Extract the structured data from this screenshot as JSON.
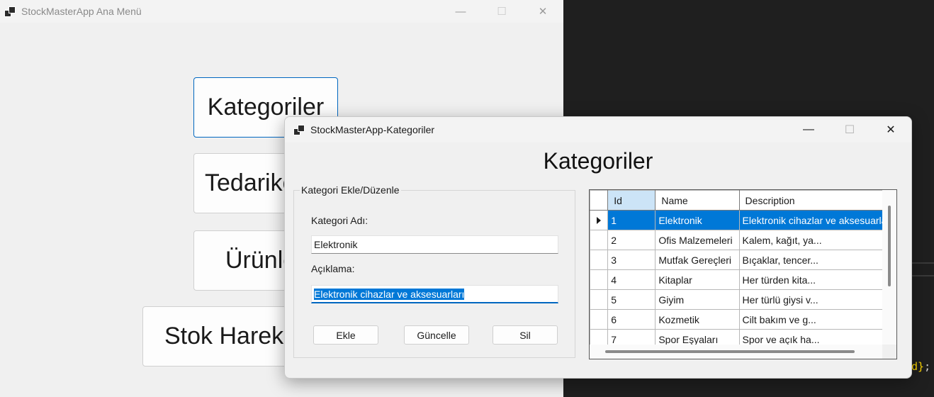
{
  "main_window": {
    "title": "StockMasterApp Ana Menü",
    "controls": {
      "minimize": "—",
      "maximize": "☐",
      "close": "✕"
    },
    "buttons": {
      "kategoriler": "Kategoriler",
      "tedarikciler": "Tedarikç",
      "urunler": "Ürünle",
      "stok_hareketleri": "Stok Hareke"
    }
  },
  "editor": {
    "snippet_bracket": "d}",
    "snippet_rest": ";"
  },
  "kategoriler_window": {
    "title": "StockMasterApp-Kategoriler",
    "controls": {
      "minimize": "—",
      "maximize": "☐",
      "close": "✕"
    },
    "heading": "Kategoriler",
    "groupbox": {
      "legend": "Kategori Ekle/Düzenle",
      "kategori_adi_label": "Kategori Adı:",
      "kategori_adi_value": "Elektronik",
      "aciklama_label": "Açıklama:",
      "aciklama_value": "Elektronik cihazlar ve aksesuarları",
      "buttons": {
        "ekle": "Ekle",
        "guncelle": "Güncelle",
        "sil": "Sil"
      }
    },
    "grid": {
      "columns": [
        "Id",
        "Name",
        "Description"
      ],
      "rows": [
        {
          "id": "1",
          "name": "Elektronik",
          "description": "Elektronik cihazlar ve aksesuarları",
          "selected": true
        },
        {
          "id": "2",
          "name": "Ofis Malzemeleri",
          "description": "Kalem, kağıt, ya..."
        },
        {
          "id": "3",
          "name": "Mutfak Gereçleri",
          "description": "Bıçaklar, tencer..."
        },
        {
          "id": "4",
          "name": "Kitaplar",
          "description": "Her türden kita..."
        },
        {
          "id": "5",
          "name": "Giyim",
          "description": "Her türlü giysi v..."
        },
        {
          "id": "6",
          "name": "Kozmetik",
          "description": "Cilt bakım ve g..."
        },
        {
          "id": "7",
          "name": "Spor Eşyaları",
          "description": "Spor ve açık ha..."
        }
      ]
    }
  }
}
